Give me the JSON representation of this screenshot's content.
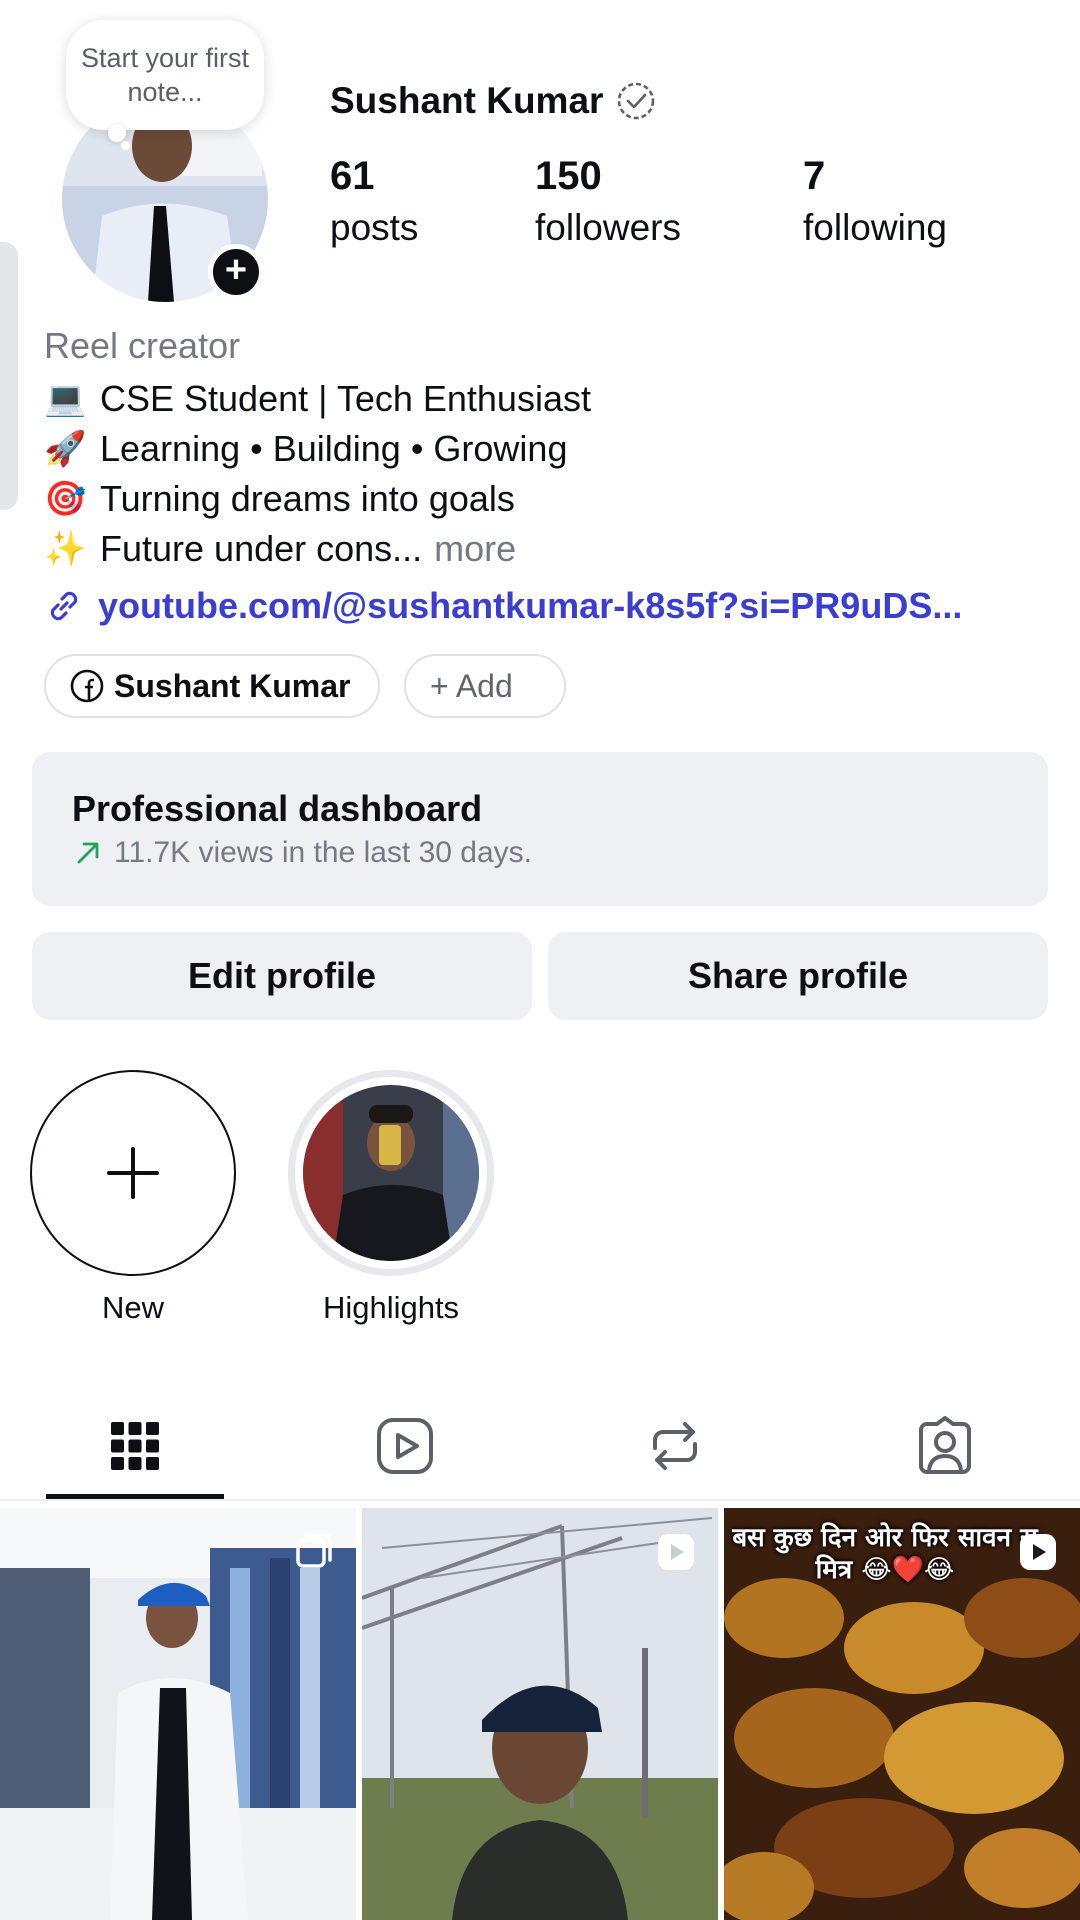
{
  "note": {
    "text": "Start your first note..."
  },
  "profile": {
    "name": "Sushant Kumar",
    "stats": [
      {
        "value": "61",
        "label": "posts"
      },
      {
        "value": "150",
        "label": "followers"
      },
      {
        "value": "7",
        "label": "following"
      }
    ],
    "category": "Reel creator",
    "bio": [
      {
        "emoji": "💻",
        "text": "CSE Student | Tech Enthusiast"
      },
      {
        "emoji": "🚀",
        "text": "Learning • Building • Growing"
      },
      {
        "emoji": "🎯",
        "text": "Turning dreams into goals"
      },
      {
        "emoji": "✨",
        "text": "Future under cons..."
      }
    ],
    "more_label": "more",
    "link": "youtube.com/@sushantkumar-k8s5f?si=PR9uDS...",
    "facebook_chip": "Sushant Kumar",
    "add_chip": "+ Add"
  },
  "dashboard": {
    "title": "Professional dashboard",
    "subtitle": "11.7K views in the last 30 days."
  },
  "buttons": {
    "edit": "Edit profile",
    "share": "Share profile"
  },
  "highlights": [
    {
      "label": "New"
    },
    {
      "label": "Highlights"
    }
  ],
  "tabs": [
    "grid-icon",
    "reels-icon",
    "reposts-icon",
    "tagged-icon"
  ],
  "posts": [
    {
      "type": "carousel"
    },
    {
      "type": "reel"
    },
    {
      "type": "reel",
      "caption": "बस कुछ दिन ओर फिर सावन स मित्र 😂❤️😂"
    }
  ],
  "colors": {
    "link": "#3b3fd1",
    "muted": "#737a82",
    "trend": "#22a35a"
  }
}
